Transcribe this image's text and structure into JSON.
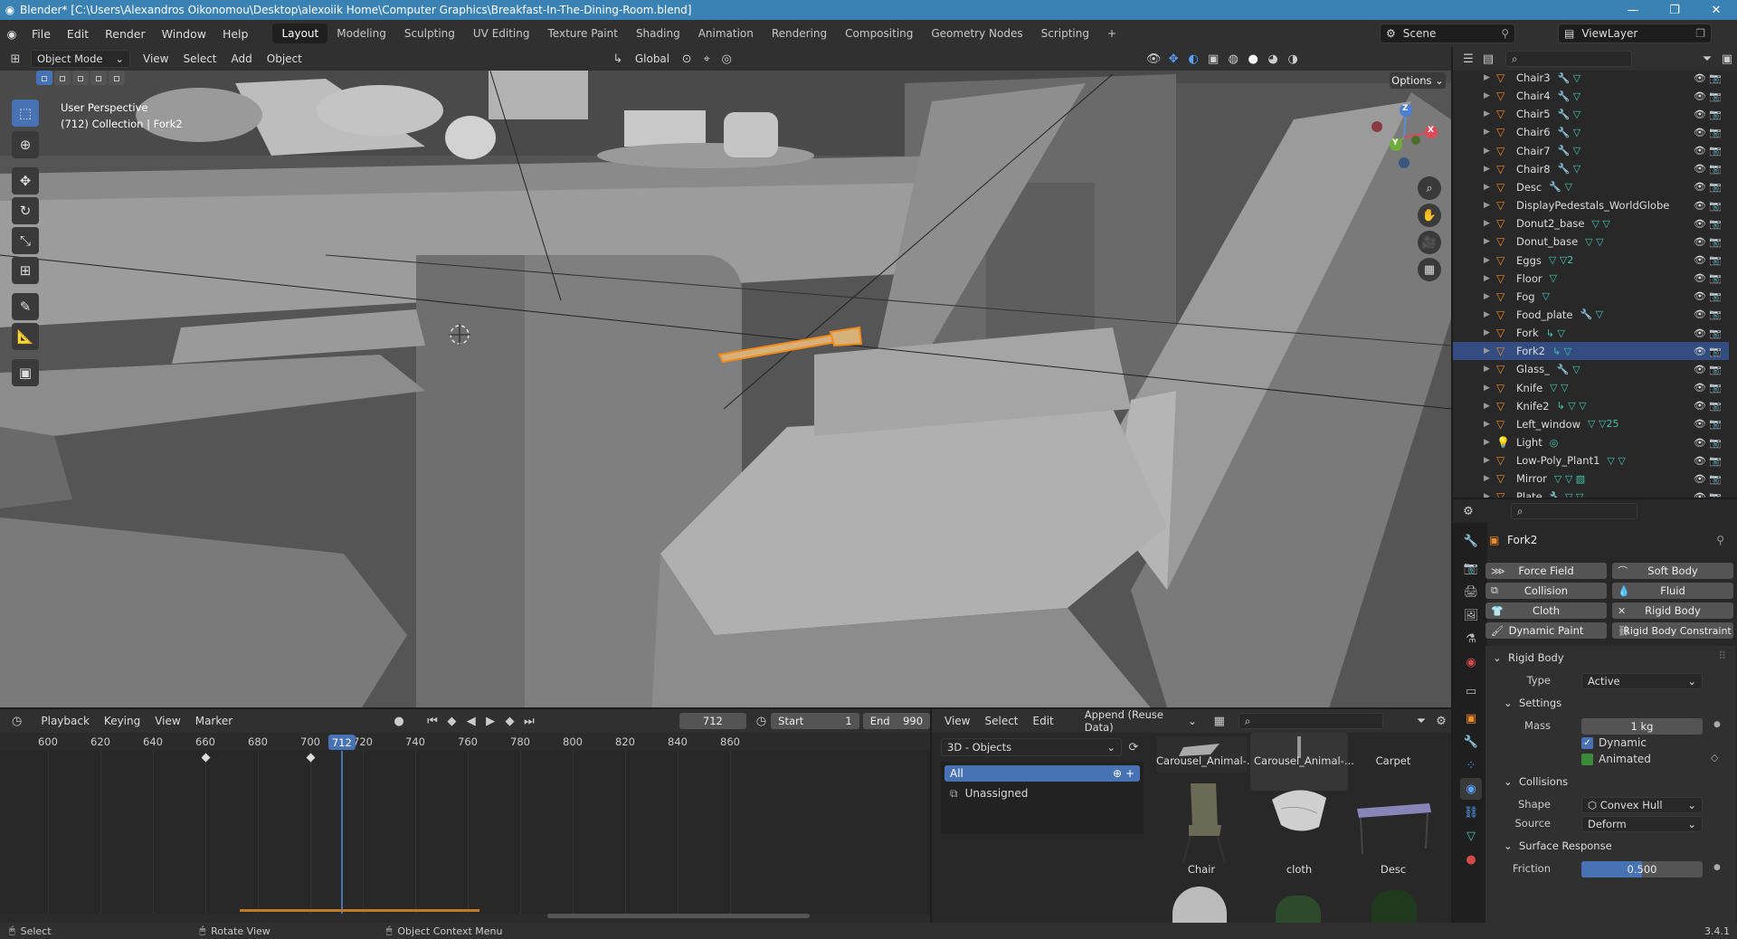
{
  "window": {
    "title": "Blender* [C:\\Users\\Alexandros Oikonomou\\Desktop\\alexoiik Home\\Computer Graphics\\Breakfast-In-The-Dining-Room.blend]",
    "minimize": "—",
    "maximize": "❐",
    "close": "✕"
  },
  "menu": [
    "File",
    "Edit",
    "Render",
    "Window",
    "Help"
  ],
  "workspaces": [
    "Layout",
    "Modeling",
    "Sculpting",
    "UV Editing",
    "Texture Paint",
    "Shading",
    "Animation",
    "Rendering",
    "Compositing",
    "Geometry Nodes",
    "Scripting"
  ],
  "active_workspace": "Layout",
  "scene": "Scene",
  "view_layer": "ViewLayer",
  "viewport": {
    "mode": "Object Mode",
    "menus": [
      "View",
      "Select",
      "Add",
      "Object"
    ],
    "transform_orientation": "Global",
    "options_label": "Options",
    "overlay_line1": "User Perspective",
    "overlay_line2": "(712) Collection | Fork2",
    "gizmo_axes": {
      "z": "Z",
      "x": "X",
      "y": "Y"
    }
  },
  "outliner": {
    "rows": [
      {
        "name": "Chair3",
        "mods": "🔧 ▽",
        "selected": false
      },
      {
        "name": "Chair4",
        "mods": "🔧 ▽",
        "selected": false
      },
      {
        "name": "Chair5",
        "mods": "🔧 ▽",
        "selected": false
      },
      {
        "name": "Chair6",
        "mods": "🔧 ▽",
        "selected": false
      },
      {
        "name": "Chair7",
        "mods": "🔧 ▽",
        "selected": false
      },
      {
        "name": "Chair8",
        "mods": "🔧 ▽",
        "selected": false
      },
      {
        "name": "Desc",
        "mods": "🔧 ▽",
        "selected": false
      },
      {
        "name": "DisplayPedestals_WorldGlobe",
        "mods": "",
        "selected": false
      },
      {
        "name": "Donut2_base",
        "mods": "▽ ▽",
        "selected": false
      },
      {
        "name": "Donut_base",
        "mods": "▽ ▽",
        "selected": false
      },
      {
        "name": "Eggs",
        "mods": "▽ ▽2",
        "selected": false
      },
      {
        "name": "Floor",
        "mods": "▽",
        "selected": false
      },
      {
        "name": "Fog",
        "mods": "▽",
        "selected": false
      },
      {
        "name": "Food_plate",
        "mods": "🔧 ▽",
        "selected": false
      },
      {
        "name": "Fork",
        "mods": "↳ ▽",
        "selected": false
      },
      {
        "name": "Fork2",
        "mods": "↳ ▽",
        "selected": true
      },
      {
        "name": "Glass_",
        "mods": "🔧 ▽",
        "selected": false
      },
      {
        "name": "Knife",
        "mods": "▽ ▽",
        "selected": false
      },
      {
        "name": "Knife2",
        "mods": "↳ ▽ ▽",
        "selected": false
      },
      {
        "name": "Left_window",
        "mods": "▽ ▽25",
        "selected": false
      },
      {
        "name": "Light",
        "mods": "◎",
        "selected": false
      },
      {
        "name": "Low-Poly_Plant1",
        "mods": "▽ ▽",
        "selected": false
      },
      {
        "name": "Mirror",
        "mods": "▽ ▽ ▧",
        "selected": false
      },
      {
        "name": "Plate",
        "mods": "🔧 ▽ ▽",
        "selected": false
      }
    ]
  },
  "properties": {
    "object_name": "Fork2",
    "physics_buttons": [
      "Force Field",
      "Soft Body",
      "Collision",
      "Fluid",
      "Cloth",
      "Rigid Body",
      "Dynamic Paint",
      "Rigid Body Constraint"
    ],
    "rigid_body_title": "Rigid Body",
    "type_label": "Type",
    "type_value": "Active",
    "settings_title": "Settings",
    "mass_label": "Mass",
    "mass_value": "1 kg",
    "dynamic_label": "Dynamic",
    "dynamic_checked": true,
    "animated_label": "Animated",
    "animated_checked": false,
    "collisions_title": "Collisions",
    "shape_label": "Shape",
    "shape_value": "Convex Hull",
    "source_label": "Source",
    "source_value": "Deform",
    "surface_title": "Surface Response",
    "friction_label": "Friction",
    "friction_value": "0.500",
    "friction_fraction": 0.5
  },
  "timeline": {
    "menus": [
      "Playback",
      "Keying",
      "View",
      "Marker"
    ],
    "current_frame": "712",
    "start_label": "Start",
    "start_value": "1",
    "end_label": "End",
    "end_value": "990",
    "ticks": [
      "600",
      "620",
      "640",
      "660",
      "680",
      "700",
      "720",
      "740",
      "760",
      "780",
      "800",
      "820",
      "840",
      "860"
    ],
    "keyframes": [
      660,
      700
    ]
  },
  "asset_browser": {
    "menus": [
      "View",
      "Select",
      "Edit"
    ],
    "import_mode": "Append (Reuse Data)",
    "library": "3D - Objects",
    "catalogs": [
      "All",
      "Unassigned"
    ],
    "assets_row1": [
      "Carousel_Animal-...",
      "Carousel_Animal-...",
      "Carpet"
    ],
    "assets_row2": [
      "Chair",
      "cloth",
      "Desc"
    ]
  },
  "status": {
    "select": "Select",
    "rotate": "Rotate View",
    "context": "Object Context Menu",
    "version": "3.4.1"
  }
}
